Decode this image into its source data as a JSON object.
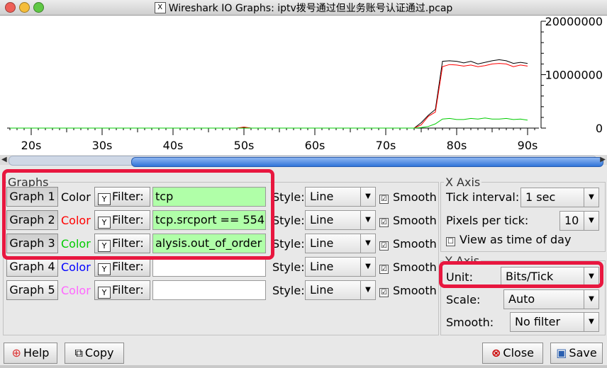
{
  "window": {
    "title": "Wireshark IO Graphs: iptv拨号通过但业务账号认证通过.pcap",
    "app_icon": "wireshark-x-icon"
  },
  "colors": {
    "graph1": "#000000",
    "graph2": "#ff0000",
    "graph3": "#00cc00",
    "graph4": "#0000ff",
    "graph5": "#ff66ff",
    "filter_active_bg": "#b0ffa8",
    "highlight": "#e8173f"
  },
  "chart_data": {
    "type": "line",
    "x": [
      "17s",
      "18s",
      "19s",
      "20s",
      "21s",
      "22s",
      "23s",
      "24s",
      "25s",
      "26s",
      "27s",
      "28s",
      "29s",
      "30s",
      "31s",
      "32s",
      "33s",
      "34s",
      "35s",
      "36s",
      "37s",
      "38s",
      "39s",
      "40s",
      "41s",
      "42s",
      "43s",
      "44s",
      "45s",
      "46s",
      "47s",
      "48s",
      "49s",
      "50s",
      "51s",
      "52s",
      "53s",
      "54s",
      "55s",
      "56s",
      "57s",
      "58s",
      "59s",
      "60s",
      "61s",
      "62s",
      "63s",
      "64s",
      "65s",
      "66s",
      "67s",
      "68s",
      "69s",
      "70s",
      "71s",
      "72s",
      "73s",
      "74s",
      "75s",
      "76s",
      "77s",
      "78s",
      "79s",
      "80s",
      "81s",
      "82s",
      "83s",
      "84s",
      "85s",
      "86s",
      "87s",
      "88s",
      "89s",
      "90s"
    ],
    "series": [
      {
        "name": "Graph 1",
        "values": [
          0,
          0,
          0,
          0,
          0,
          0,
          0,
          0,
          0,
          0,
          0,
          0,
          0,
          0,
          0,
          0,
          0,
          0,
          0,
          0,
          0,
          0,
          0,
          0,
          0,
          0,
          0,
          0,
          0,
          0,
          0,
          0,
          0,
          100000,
          0,
          0,
          0,
          0,
          0,
          0,
          0,
          0,
          0,
          0,
          0,
          0,
          0,
          0,
          0,
          0,
          0,
          0,
          0,
          0,
          0,
          0,
          0,
          0,
          1000000,
          2400000,
          3500000,
          12500000,
          12600000,
          12500000,
          12200000,
          12500000,
          12000000,
          12300000,
          12600000,
          12800000,
          12600000,
          12100000,
          12300000,
          12100000,
          3000000
        ]
      },
      {
        "name": "Graph 2",
        "values": [
          0,
          0,
          0,
          0,
          0,
          0,
          0,
          0,
          0,
          0,
          0,
          0,
          0,
          0,
          0,
          0,
          0,
          0,
          0,
          0,
          0,
          0,
          0,
          0,
          0,
          0,
          0,
          0,
          0,
          0,
          0,
          0,
          0,
          200000,
          0,
          0,
          0,
          0,
          0,
          0,
          0,
          0,
          0,
          0,
          0,
          0,
          0,
          0,
          0,
          0,
          0,
          0,
          0,
          0,
          0,
          0,
          0,
          0,
          600000,
          2200000,
          3000000,
          11500000,
          11900000,
          11800000,
          11600000,
          11800000,
          11500000,
          11700000,
          12000000,
          12100000,
          12000000,
          11500000,
          11800000,
          11600000,
          2500000
        ]
      },
      {
        "name": "Graph 3",
        "values": [
          0,
          0,
          0,
          0,
          0,
          0,
          0,
          0,
          0,
          0,
          0,
          0,
          0,
          0,
          0,
          0,
          0,
          0,
          0,
          0,
          0,
          0,
          0,
          0,
          0,
          0,
          0,
          0,
          0,
          0,
          0,
          0,
          0,
          0,
          0,
          0,
          0,
          0,
          0,
          0,
          0,
          0,
          0,
          0,
          0,
          0,
          0,
          0,
          0,
          0,
          0,
          0,
          0,
          0,
          0,
          0,
          0,
          0,
          100000,
          300000,
          800000,
          1700000,
          1800000,
          1600000,
          1600000,
          1800000,
          1700000,
          1900000,
          1700000,
          1700000,
          1800000,
          1600000,
          1700000,
          1500000,
          300000
        ]
      }
    ],
    "x_ticks": [
      "20s",
      "30s",
      "40s",
      "50s",
      "60s",
      "70s",
      "80s",
      "90s"
    ],
    "y_ticks": [
      "20000000",
      "10000000",
      "0"
    ],
    "ylim": [
      0,
      20000000
    ]
  },
  "graphs": {
    "legend": "Graphs",
    "color_label": "Color",
    "filter_label": "Filter:",
    "style_label": "Style:",
    "smooth_label": "Smooth",
    "rows": [
      {
        "button": "Graph 1",
        "filter": "tcp",
        "style": "Line",
        "smooth": "☑"
      },
      {
        "button": "Graph 2",
        "filter": "tcp.srcport == 554",
        "style": "Line",
        "smooth": "☑"
      },
      {
        "button": "Graph 3",
        "filter": "alysis.out_of_order",
        "style": "Line",
        "smooth": "☑"
      },
      {
        "button": "Graph 4",
        "filter": "",
        "style": "Line",
        "smooth": "☑"
      },
      {
        "button": "Graph 5",
        "filter": "",
        "style": "Line",
        "smooth": "☑"
      }
    ]
  },
  "xaxis": {
    "legend": "X Axis",
    "tick_interval_label": "Tick interval:",
    "tick_interval_value": "1 sec",
    "pixels_label": "Pixels per tick:",
    "pixels_value": "10",
    "time_of_day_label": "View as time of day",
    "time_of_day_check": "☐"
  },
  "yaxis": {
    "legend": "Y Axis",
    "unit_label": "Unit:",
    "unit_value": "Bits/Tick",
    "scale_label": "Scale:",
    "scale_value": "Auto",
    "smooth_label": "Smooth:",
    "smooth_value": "No filter"
  },
  "buttons": {
    "help": "Help",
    "copy": "Copy",
    "close": "Close",
    "save": "Save"
  }
}
